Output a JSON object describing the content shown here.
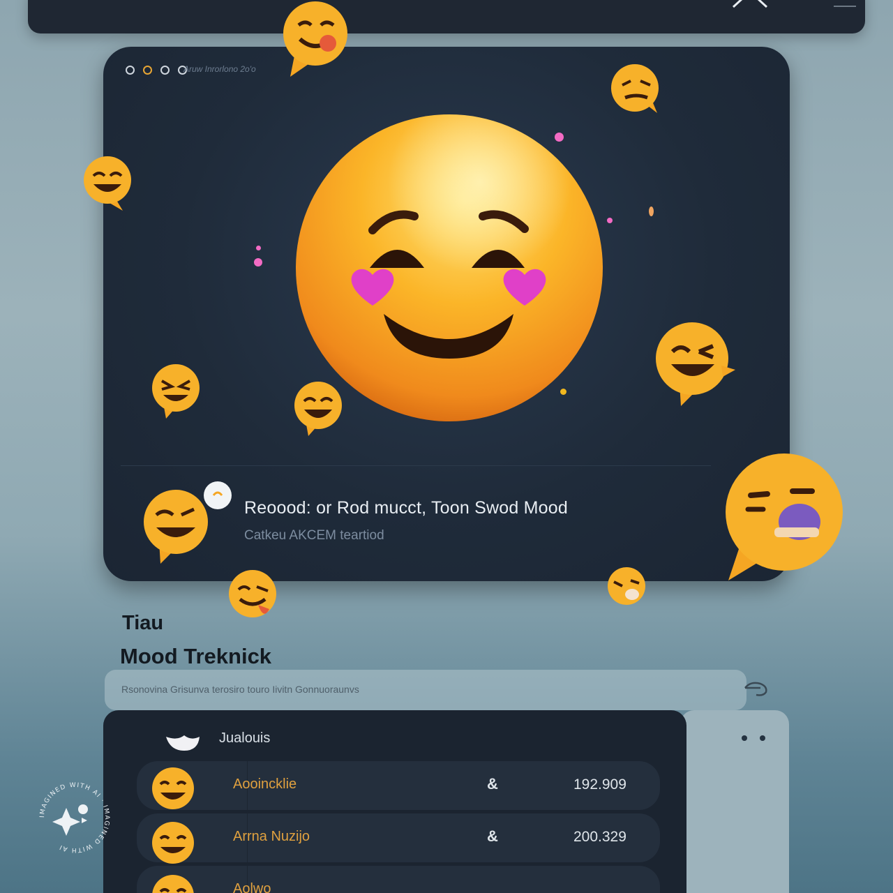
{
  "window": {
    "title": "Aruw Inrorlono 2o'o",
    "mood_title": "Reoood: or Rod mucct, Toon Swod Mood",
    "mood_subtitle": "Catkeu AKCEM teartiod"
  },
  "section": {
    "small_heading": "Tiau",
    "title": "Mood Treknick",
    "search_text": "Rsonovina Grisunva terosiro touro Iivitn Gonnuoraunvs"
  },
  "list": {
    "header": "Jualouis",
    "rows": [
      {
        "label": "Aooincklie",
        "symbol": "&",
        "value": "192.909"
      },
      {
        "label": "Arrna Nuzijo",
        "symbol": "&",
        "value": "200.329"
      },
      {
        "label": "Aolwo",
        "symbol": "",
        "value": ""
      }
    ]
  },
  "watermark": {
    "text": "IMAGINED WITH AI · IMAGINED WITH AI"
  },
  "colors": {
    "accent": "#f5a623",
    "window": "#1f2b3a",
    "background": "#8ea6b0",
    "heart": "#e040c8"
  }
}
